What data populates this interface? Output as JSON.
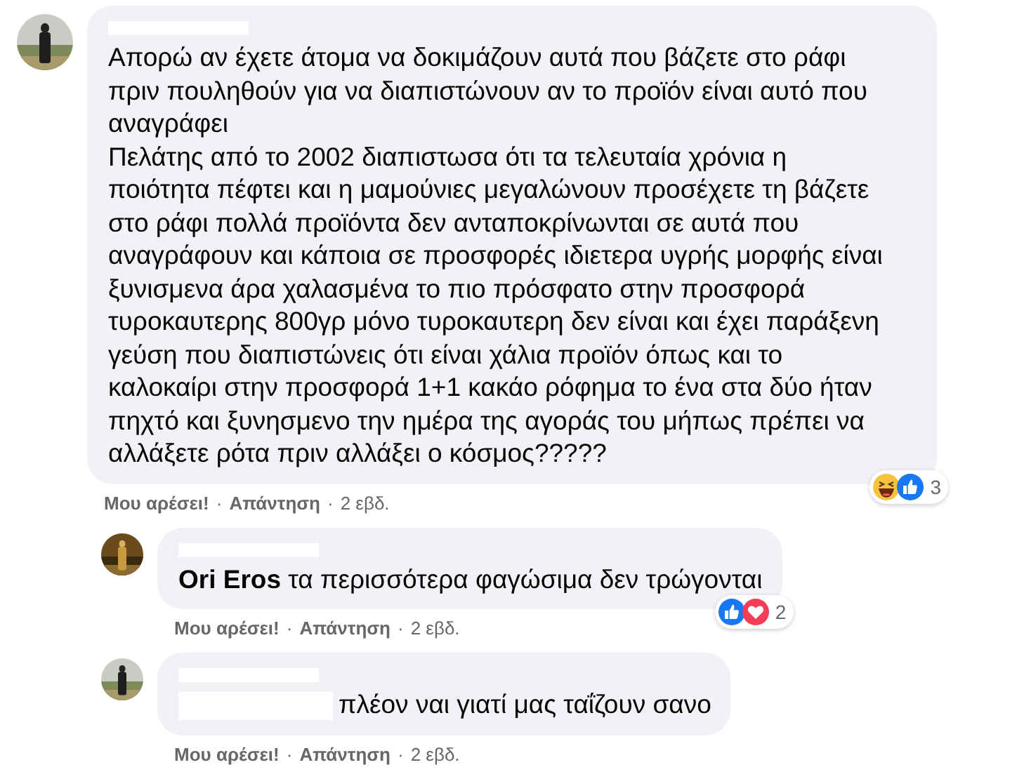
{
  "comments": [
    {
      "reply": false,
      "avatar": {
        "kind": "picture"
      },
      "name_redacted": true,
      "mention_redacted": false,
      "paragraphs": [
        "Απορώ αν έχετε άτομα να δοκιμάζουν αυτά που βάζετε στο ράφι πριν πουληθούν για να διαπιστώνουν αν το προϊόν είναι αυτό που αναγράφει",
        "Πελάτης από το 2002 διαπιστωσα ότι τα τελευταία χρόνια η ποιότητα πέφτει και η μαμούνιες μεγαλώνουν προσέχετε τη βάζετε στο ράφι πολλά προϊόντα δεν ανταποκρίνωνται σε αυτά που αναγράφουν και κάποια σε προσφορές ιδιετερα υγρής μορφής είναι ξυνισμενα άρα χαλασμένα το πιο πρόσφατο στην προσφορά τυροκαυτερης 800γρ μόνο τυροκαυτερη δεν είναι και έχει παράξενη γεύση που διαπιστώνεις ότι είναι χάλια προϊόν όπως και το καλοκαίρι στην προσφορά 1+1 κακάο ρόφημα το ένα στα δύο ήταν πηχτό και ξυνησμενο την ημέρα της αγοράς του μήπως πρέπει να αλλάξετε ρότα πριν αλλάξει ο κόσμος?????"
      ],
      "reactions": [
        {
          "kind": "haha"
        },
        {
          "kind": "like"
        }
      ],
      "reaction_count": "3",
      "actions": [
        {
          "kind": "link",
          "text": "Μου αρέσει!"
        },
        {
          "kind": "dot",
          "text": "·"
        },
        {
          "kind": "link",
          "text": "Απάντηση"
        },
        {
          "kind": "dot",
          "text": "·"
        },
        {
          "kind": "time",
          "text": "2 εβδ."
        }
      ]
    },
    {
      "reply": true,
      "avatar": {
        "kind": "picture"
      },
      "name_redacted": true,
      "mention_redacted": false,
      "paragraphs": [
        "**Ori Eros** τα περισσότερα φαγώσιμα δεν τρώγονται"
      ],
      "reactions": [
        {
          "kind": "like"
        },
        {
          "kind": "love"
        }
      ],
      "reaction_count": "2",
      "actions": [
        {
          "kind": "link",
          "text": "Μου αρέσει!"
        },
        {
          "kind": "dot",
          "text": "·"
        },
        {
          "kind": "link",
          "text": "Απάντηση"
        },
        {
          "kind": "dot",
          "text": "·"
        },
        {
          "kind": "time",
          "text": "2 εβδ."
        }
      ]
    },
    {
      "reply": true,
      "avatar": {
        "kind": "picture"
      },
      "name_redacted": true,
      "mention_redacted": true,
      "paragraphs": [
        "πλέον ναι γιατί μας ταΐζουν σανο"
      ],
      "actions": [
        {
          "kind": "link",
          "text": "Μου αρέσει!"
        },
        {
          "kind": "dot",
          "text": "·"
        },
        {
          "kind": "link",
          "text": "Απάντηση"
        },
        {
          "kind": "dot",
          "text": "·"
        },
        {
          "kind": "time",
          "text": "2 εβδ."
        }
      ]
    }
  ]
}
